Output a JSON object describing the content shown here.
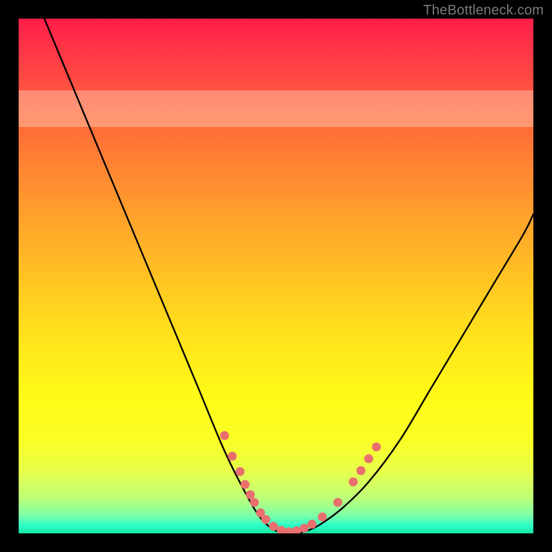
{
  "watermark": "TheBottleneck.com",
  "chart_data": {
    "type": "line",
    "title": "",
    "xlabel": "",
    "ylabel": "",
    "xlim": [
      0,
      100
    ],
    "ylim": [
      0,
      100
    ],
    "series": [
      {
        "name": "curve",
        "x": [
          5,
          10,
          15,
          20,
          25,
          30,
          35,
          40,
          44,
          47,
          50,
          53,
          56,
          59,
          63,
          68,
          74,
          80,
          86,
          92,
          98,
          100
        ],
        "y": [
          100,
          88,
          76,
          64,
          52,
          40,
          28,
          16,
          8,
          3,
          0.5,
          0,
          0.5,
          2,
          5,
          10,
          18,
          28,
          38,
          48,
          58,
          62
        ]
      }
    ],
    "markers": {
      "name": "highlight-dots",
      "color": "#e96f6f",
      "points": [
        {
          "x": 40.0,
          "y": 19.0
        },
        {
          "x": 41.5,
          "y": 15.0
        },
        {
          "x": 43.0,
          "y": 12.0
        },
        {
          "x": 44.0,
          "y": 9.5
        },
        {
          "x": 45.0,
          "y": 7.5
        },
        {
          "x": 45.8,
          "y": 6.0
        },
        {
          "x": 47.0,
          "y": 4.0
        },
        {
          "x": 48.0,
          "y": 2.7
        },
        {
          "x": 49.5,
          "y": 1.4
        },
        {
          "x": 51.0,
          "y": 0.6
        },
        {
          "x": 52.5,
          "y": 0.3
        },
        {
          "x": 54.0,
          "y": 0.5
        },
        {
          "x": 55.5,
          "y": 1.0
        },
        {
          "x": 57.0,
          "y": 1.8
        },
        {
          "x": 59.0,
          "y": 3.2
        },
        {
          "x": 62.0,
          "y": 6.0
        },
        {
          "x": 65.0,
          "y": 10.0
        },
        {
          "x": 66.5,
          "y": 12.2
        },
        {
          "x": 68.0,
          "y": 14.5
        },
        {
          "x": 69.5,
          "y": 16.8
        }
      ]
    },
    "pale_band": {
      "y_from": 79,
      "y_to": 86
    }
  }
}
